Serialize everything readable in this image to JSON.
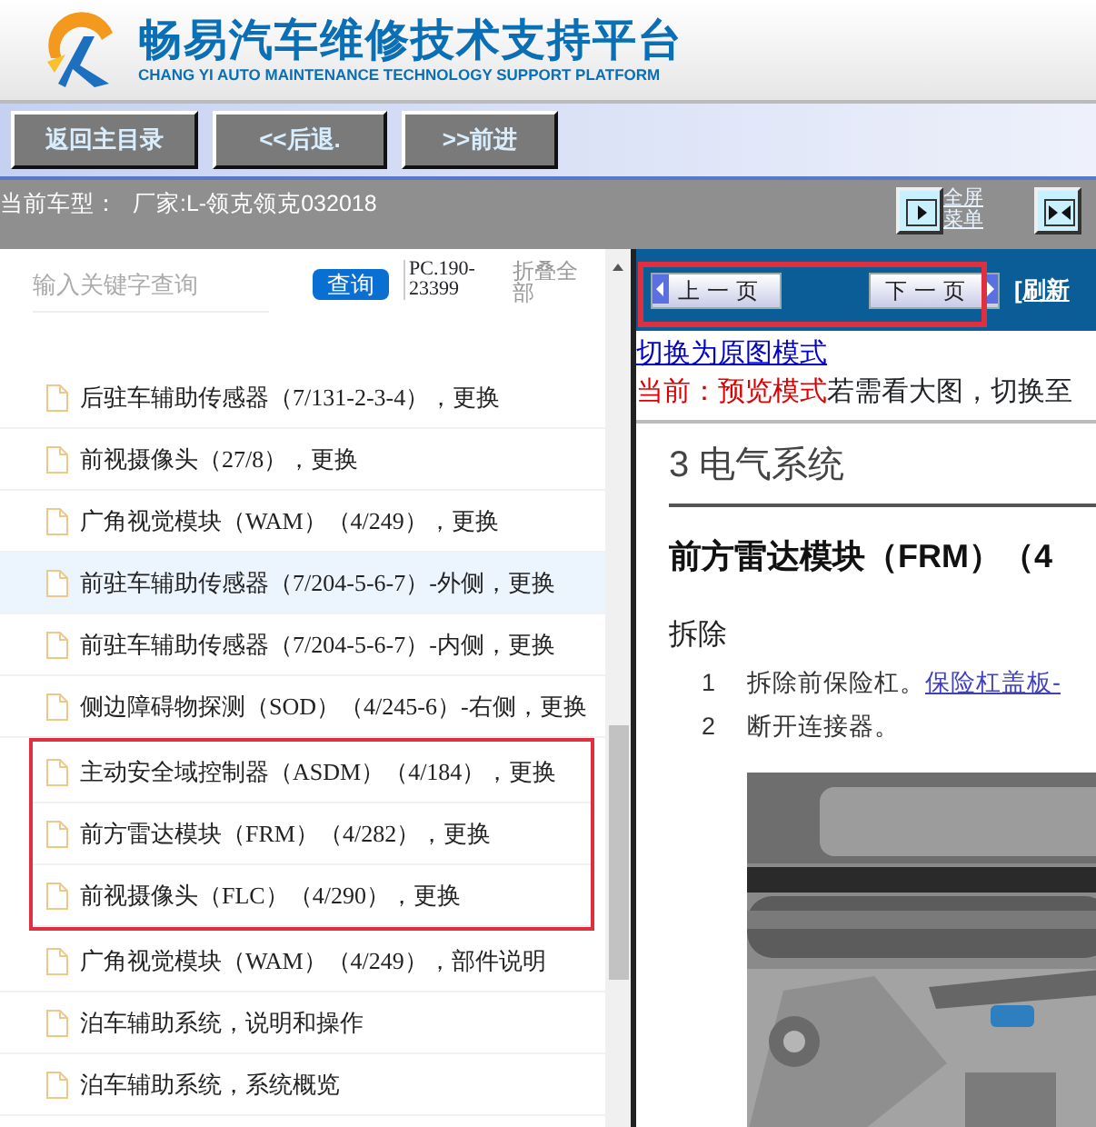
{
  "header": {
    "title": "畅易汽车维修技术支持平台",
    "subtitle": "CHANG YI AUTO MAINTENANCE TECHNOLOGY SUPPORT PLATFORM"
  },
  "toolbar": {
    "buttons": [
      "返回主目录",
      "<<后退.",
      ">>前进"
    ]
  },
  "vehicle_bar": {
    "label": "当前车型：",
    "value": "厂家:L-领克领克032018",
    "actions": [
      {
        "kind": "fullscreen",
        "label_lines": [
          "全屏",
          "菜单"
        ]
      },
      {
        "kind": "default_view"
      }
    ]
  },
  "sidebar": {
    "search": {
      "placeholder": "输入关键字查询",
      "button": "查询"
    },
    "code": "PC.190-23399",
    "collapse": "折叠全部",
    "items": [
      {
        "label": "后驻车辅助传感器（7/131-2-3-4），更换",
        "selected": false,
        "highlighted": false
      },
      {
        "label": "前视摄像头（27/8），更换",
        "selected": false,
        "highlighted": false
      },
      {
        "label": "广角视觉模块（WAM）（4/249），更换",
        "selected": false,
        "highlighted": false
      },
      {
        "label": "前驻车辅助传感器（7/204-5-6-7）-外侧，更换",
        "selected": true,
        "highlighted": false
      },
      {
        "label": "前驻车辅助传感器（7/204-5-6-7）-内侧，更换",
        "selected": false,
        "highlighted": false
      },
      {
        "label": "侧边障碍物探测（SOD）（4/245-6）-右侧，更换",
        "selected": false,
        "highlighted": false
      },
      {
        "label": "主动安全域控制器（ASDM）（4/184），更换",
        "selected": false,
        "highlighted": true
      },
      {
        "label": "前方雷达模块（FRM）（4/282），更换",
        "selected": false,
        "highlighted": true
      },
      {
        "label": "前视摄像头（FLC）（4/290），更换",
        "selected": false,
        "highlighted": true
      },
      {
        "label": "广角视觉模块（WAM）（4/249），部件说明",
        "selected": false,
        "highlighted": false
      },
      {
        "label": "泊车辅助系统，说明和操作",
        "selected": false,
        "highlighted": false
      },
      {
        "label": "泊车辅助系统，系统概览",
        "selected": false,
        "highlighted": false
      }
    ]
  },
  "viewer": {
    "nav": {
      "prev": "上一页",
      "next": "下一页",
      "refresh": "[刷新",
      "highlighted": true
    },
    "switch_link": "切换为原图模式",
    "mode_notice": {
      "label": "当前：预览模式",
      "text": "若需看大图，切换至"
    },
    "document": {
      "section": "3 电气系统",
      "title": "前方雷达模块（FRM）（4",
      "subtitle": "拆除",
      "steps": [
        {
          "number": "1",
          "text": "拆除前保险杠。",
          "link": "保险杠盖板-"
        },
        {
          "number": "2",
          "text": "断开连接器。"
        }
      ]
    }
  }
}
